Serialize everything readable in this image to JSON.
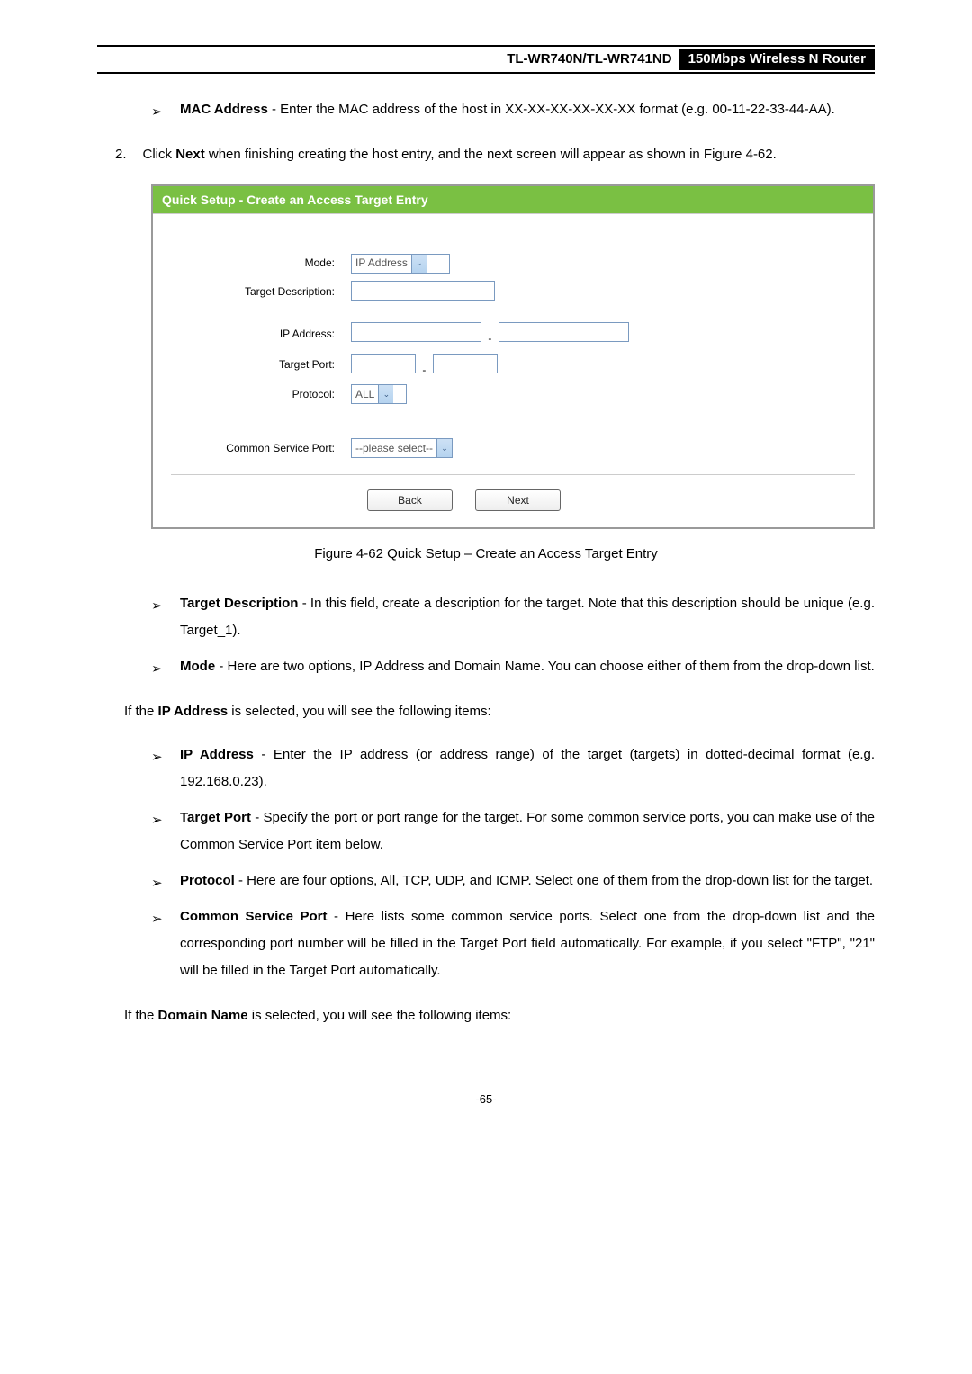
{
  "header": {
    "model": "TL-WR740N/TL-WR741ND",
    "description": "150Mbps Wireless N Router"
  },
  "first_bullet": {
    "label": "MAC Address",
    "text": "- Enter the MAC address of the host in XX-XX-XX-XX-XX-XX format (e.g. 00-11-22-33-44-AA)."
  },
  "step": {
    "num": "2.",
    "text_before": "Click ",
    "bold": "Next",
    "text_after": " when finishing creating the host entry, and the next screen will appear as shown in Figure 4-62."
  },
  "figure": {
    "title": "Quick Setup - Create an Access Target Entry",
    "labels": {
      "mode": "Mode:",
      "target_description": "Target Description:",
      "ip_address": "IP Address:",
      "target_port": "Target Port:",
      "protocol": "Protocol:",
      "common_service_port": "Common Service Port:"
    },
    "values": {
      "mode": "IP Address",
      "protocol": "ALL",
      "common_service_port": "--please select--"
    },
    "buttons": {
      "back": "Back",
      "next": "Next"
    }
  },
  "caption": "Figure 4-62    Quick Setup – Create an Access Target Entry",
  "bullets": [
    {
      "label": "Target Description",
      "text": " - In this field, create a description for the target. Note that this description should be unique (e.g. Target_1)."
    },
    {
      "label": "Mode",
      "text": " - Here are two options, IP Address and Domain Name. You can choose either of them from the drop-down list."
    }
  ],
  "para_if_ip": {
    "pre": "If the ",
    "bold": "IP Address",
    "post": " is selected, you will see the following items:"
  },
  "bullets2": [
    {
      "label": "IP Address",
      "text": " - Enter the IP address (or address range) of the target (targets) in dotted-decimal format (e.g. 192.168.0.23)."
    },
    {
      "label": "Target Port",
      "text": " - Specify the port or port range for the target. For some common service ports, you can make use of the Common Service Port item below."
    },
    {
      "label": "Protocol",
      "text": " - Here are four options, All, TCP, UDP, and ICMP. Select one of them from the drop-down list for the target."
    },
    {
      "label": "Common Service Port",
      "text": " - Here lists some common service ports. Select one from the drop-down list and the corresponding port number will be filled in the Target Port field automatically. For example, if you select \"FTP\", \"21\" will be filled in the Target Port automatically."
    }
  ],
  "para_if_domain": {
    "pre": "If the ",
    "bold": "Domain Name",
    "post": " is selected, you will see the following items:"
  },
  "page_number": "-65-"
}
